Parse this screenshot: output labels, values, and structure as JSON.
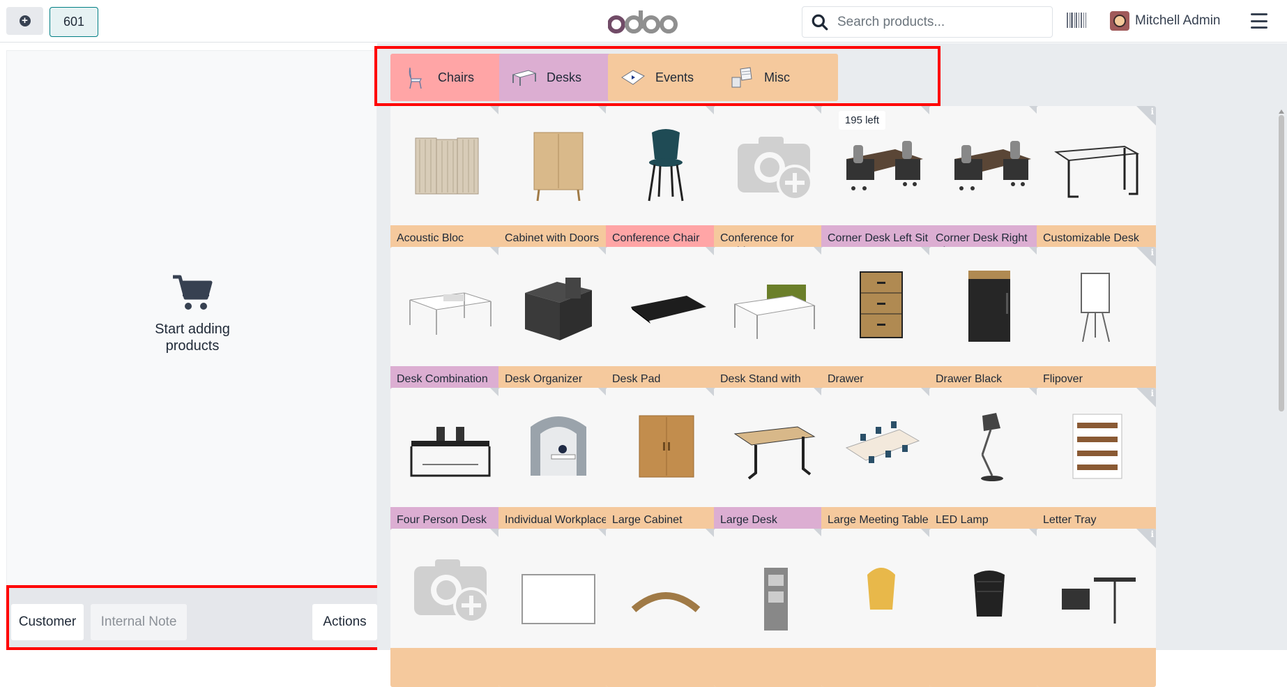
{
  "header": {
    "order_number": "601",
    "logo_text": "odoo",
    "search_placeholder": "Search products...",
    "user_name": "Mitchell Admin"
  },
  "cart": {
    "empty_text": "Start adding products"
  },
  "actions_bar": {
    "customer_label": "Customer",
    "note_label": "Internal Note",
    "actions_label": "Actions"
  },
  "categories": [
    {
      "label": "Chairs",
      "color": "#ffa5a6",
      "icon": "chair-icon"
    },
    {
      "label": "Desks",
      "color": "#dcaed2",
      "icon": "desk-icon"
    },
    {
      "label": "Events",
      "color": "#f5c99d",
      "icon": "ticket-icon"
    },
    {
      "label": "Misc",
      "color": "#f5c99d",
      "icon": "misc-icon"
    }
  ],
  "stock_badge": "195 left",
  "products": [
    {
      "name": "Acoustic Bloc Screens",
      "color": "orange",
      "icon": "screens-icon"
    },
    {
      "name": "Cabinet with Doors",
      "color": "orange",
      "icon": "cabinet-icon"
    },
    {
      "name": "Conference Chair",
      "color": "pink",
      "icon": "chair-icon"
    },
    {
      "name": "Conference for Architects",
      "color": "orange",
      "icon": "camera-placeholder-icon"
    },
    {
      "name": "Corner Desk Left Sit",
      "color": "purple",
      "icon": "corner-desk-icon"
    },
    {
      "name": "Corner Desk Right Sit",
      "color": "purple",
      "icon": "corner-desk-icon"
    },
    {
      "name": "Customizable Desk",
      "color": "orange",
      "icon": "table-icon"
    },
    {
      "name": "Desk Combination",
      "color": "purple",
      "icon": "desk-combination-icon"
    },
    {
      "name": "Desk Organizer",
      "color": "orange",
      "icon": "organizer-icon"
    },
    {
      "name": "Desk Pad",
      "color": "orange",
      "icon": "pad-icon"
    },
    {
      "name": "Desk Stand with Screen",
      "color": "orange",
      "icon": "desk-stand-icon"
    },
    {
      "name": "Drawer",
      "color": "orange",
      "icon": "drawer-icon"
    },
    {
      "name": "Drawer Black",
      "color": "orange",
      "icon": "drawer-black-icon"
    },
    {
      "name": "Flipover",
      "color": "orange",
      "icon": "flipover-icon"
    },
    {
      "name": "Four Person Desk",
      "color": "purple",
      "icon": "four-person-desk-icon"
    },
    {
      "name": "Individual Workplace",
      "color": "orange",
      "icon": "workplace-pod-icon"
    },
    {
      "name": "Large Cabinet",
      "color": "orange",
      "icon": "large-cabinet-icon"
    },
    {
      "name": "Large Desk",
      "color": "purple",
      "icon": "large-desk-icon"
    },
    {
      "name": "Large Meeting Table",
      "color": "orange",
      "icon": "meeting-table-icon"
    },
    {
      "name": "LED Lamp",
      "color": "orange",
      "icon": "lamp-icon"
    },
    {
      "name": "Letter Tray",
      "color": "orange",
      "icon": "letter-tray-icon"
    },
    {
      "name": "",
      "color": "orange",
      "icon": "camera-placeholder-icon"
    },
    {
      "name": "",
      "color": "orange",
      "icon": "whiteboard-icon"
    },
    {
      "name": "",
      "color": "orange",
      "icon": "monitor-stand-icon"
    },
    {
      "name": "",
      "color": "orange",
      "icon": "shelf-icon"
    },
    {
      "name": "",
      "color": "orange",
      "icon": "chair-yellow-icon"
    },
    {
      "name": "",
      "color": "orange",
      "icon": "office-chair-icon"
    },
    {
      "name": "",
      "color": "orange",
      "icon": "desk-setup-icon"
    }
  ]
}
